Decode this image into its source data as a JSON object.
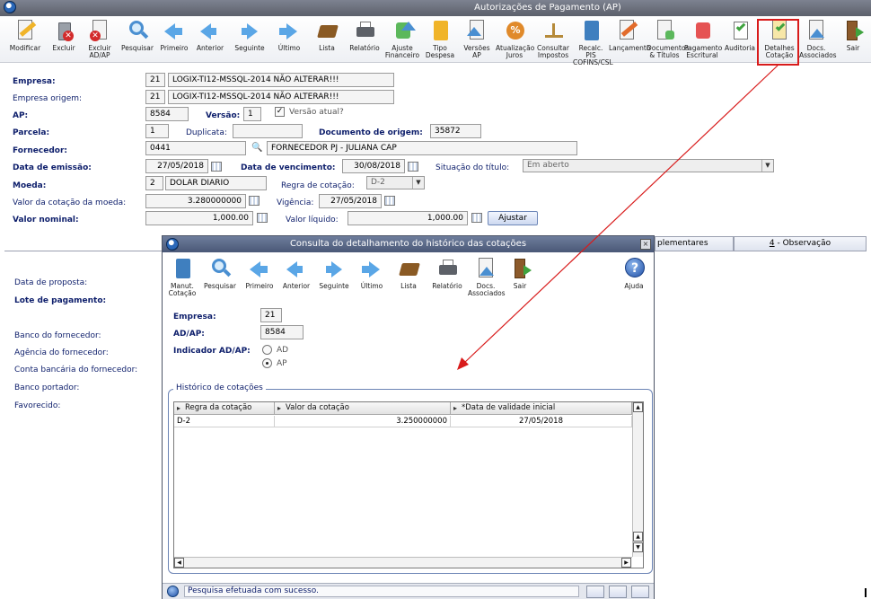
{
  "window": {
    "title": "Autorizações de Pagamento (AP)"
  },
  "toolbar": {
    "items": [
      {
        "label": "Modificar",
        "icon": "pencil-icon"
      },
      {
        "label": "Excluir",
        "icon": "trash-icon"
      },
      {
        "label": "Excluir\nAD/AP",
        "icon": "delete-ad-ap-icon"
      },
      {
        "label": "Pesquisar",
        "icon": "search-icon"
      },
      {
        "label": "Primeiro",
        "icon": "first-arrow-icon"
      },
      {
        "label": "Anterior",
        "icon": "previous-arrow-icon"
      },
      {
        "label": "Seguinte",
        "icon": "next-arrow-icon"
      },
      {
        "label": "Último",
        "icon": "last-arrow-icon"
      },
      {
        "label": "Lista",
        "icon": "book-icon"
      },
      {
        "label": "Relatório",
        "icon": "printer-icon"
      },
      {
        "label": "Ajuste\nFinanceiro",
        "icon": "financial-adjust-icon"
      },
      {
        "label": "Tipo\nDespesa",
        "icon": "expense-type-icon"
      },
      {
        "label": "Versões\nAP",
        "icon": "versions-icon"
      },
      {
        "label": "Atualização\nJuros",
        "icon": "percent-icon"
      },
      {
        "label": "Consultar\nImpostos",
        "icon": "scale-icon"
      },
      {
        "label": "Recalc. PIS\nCOFINS/CSL",
        "icon": "calculator-icon"
      },
      {
        "label": "Lançamento",
        "icon": "entry-icon"
      },
      {
        "label": "Documentos\n& Títulos",
        "icon": "documents-icon"
      },
      {
        "label": "Pagamento\nEscritural",
        "icon": "payment-icon"
      },
      {
        "label": "Auditoria",
        "icon": "audit-icon"
      },
      {
        "label": "Detalhes\nCotação",
        "icon": "quote-details-icon"
      },
      {
        "label": "Docs.\nAssociados",
        "icon": "associated-docs-icon"
      },
      {
        "label": "Sair",
        "icon": "exit-door-icon"
      }
    ]
  },
  "form": {
    "empresa": {
      "label": "Empresa:",
      "code": "21",
      "name": "LOGIX-TI12-MSSQL-2014 NÃO ALTERAR!!!"
    },
    "empresa_origem": {
      "label": "Empresa origem:",
      "code": "21",
      "name": "LOGIX-TI12-MSSQL-2014 NÃO ALTERAR!!!"
    },
    "ap": {
      "label": "AP:",
      "value": "8584"
    },
    "versao": {
      "label": "Versão:",
      "value": "1"
    },
    "versao_atual": {
      "label": "Versão atual?"
    },
    "parcela": {
      "label": "Parcela:",
      "value": "1"
    },
    "duplicata": {
      "label": "Duplicata:",
      "value": ""
    },
    "documento_origem": {
      "label": "Documento de origem:",
      "value": "35872"
    },
    "fornecedor": {
      "label": "Fornecedor:",
      "code": "0441",
      "name": "FORNECEDOR PJ - JULIANA CAP"
    },
    "data_emissao": {
      "label": "Data de emissão:",
      "value": "27/05/2018"
    },
    "data_vencimento": {
      "label": "Data de vencimento:",
      "value": "30/08/2018"
    },
    "situacao": {
      "label": "Situação do título:",
      "value": "Em aberto"
    },
    "moeda": {
      "label": "Moeda:",
      "code": "2",
      "name": "DOLAR DIARIO"
    },
    "regra_cotacao": {
      "label": "Regra de cotação:",
      "value": "D-2"
    },
    "valor_cotacao": {
      "label": "Valor da cotação da moeda:",
      "value": "3.280000000"
    },
    "vigencia": {
      "label": "Vigência:",
      "value": "27/05/2018"
    },
    "valor_nominal": {
      "label": "Valor nominal:",
      "value": "1,000.00"
    },
    "valor_liquido": {
      "label": "Valor líquido:",
      "value": "1,000.00"
    },
    "ajustar": "Ajustar"
  },
  "tabs": {
    "partial": "plementares",
    "observacao_num": "4",
    "observacao": " - Observação"
  },
  "lower_labels": {
    "data_proposta": "Data de proposta:",
    "lote": "Lote de pagamento:",
    "banco_fornecedor": "Banco do fornecedor:",
    "agencia_fornecedor": "Agência do fornecedor:",
    "conta_fornecedor": "Conta bancária do fornecedor:",
    "banco_portador": "Banco portador:",
    "favorecido": "Favorecido:"
  },
  "dialog": {
    "title": "Consulta do detalhamento do histórico das cotações",
    "close": "×",
    "toolbar": [
      {
        "label": "Manut.\nCotação",
        "icon": "calculator-icon"
      },
      {
        "label": "Pesquisar",
        "icon": "search-icon"
      },
      {
        "label": "Primeiro",
        "icon": "first-arrow-icon"
      },
      {
        "label": "Anterior",
        "icon": "previous-arrow-icon"
      },
      {
        "label": "Seguinte",
        "icon": "next-arrow-icon"
      },
      {
        "label": "Último",
        "icon": "last-arrow-icon"
      },
      {
        "label": "Lista",
        "icon": "book-icon"
      },
      {
        "label": "Relatório",
        "icon": "printer-icon"
      },
      {
        "label": "Docs.\nAssociados",
        "icon": "associated-docs-icon"
      },
      {
        "label": "Sair",
        "icon": "exit-door-icon"
      }
    ],
    "help": {
      "label": "Ajuda",
      "icon": "help-icon"
    },
    "empresa": {
      "label": "Empresa:",
      "value": "21"
    },
    "adap": {
      "label": "AD/AP:",
      "value": "8584"
    },
    "indicador": {
      "label": "Indicador AD/AP:",
      "options": [
        "AD",
        "AP"
      ],
      "selected": "AP"
    },
    "historico_title": "Histórico de cotações",
    "grid": {
      "columns": [
        "Regra da cotação",
        "Valor da cotação",
        "*Data de validade inicial"
      ],
      "rows": [
        [
          "D-2",
          "3.250000000",
          "27/05/2018"
        ]
      ]
    },
    "status": "Pesquisa efetuada com sucesso."
  },
  "colors": {
    "highlight": "#d81b1b",
    "arrow": "#d81b1b",
    "label": "#0d1e6b"
  }
}
